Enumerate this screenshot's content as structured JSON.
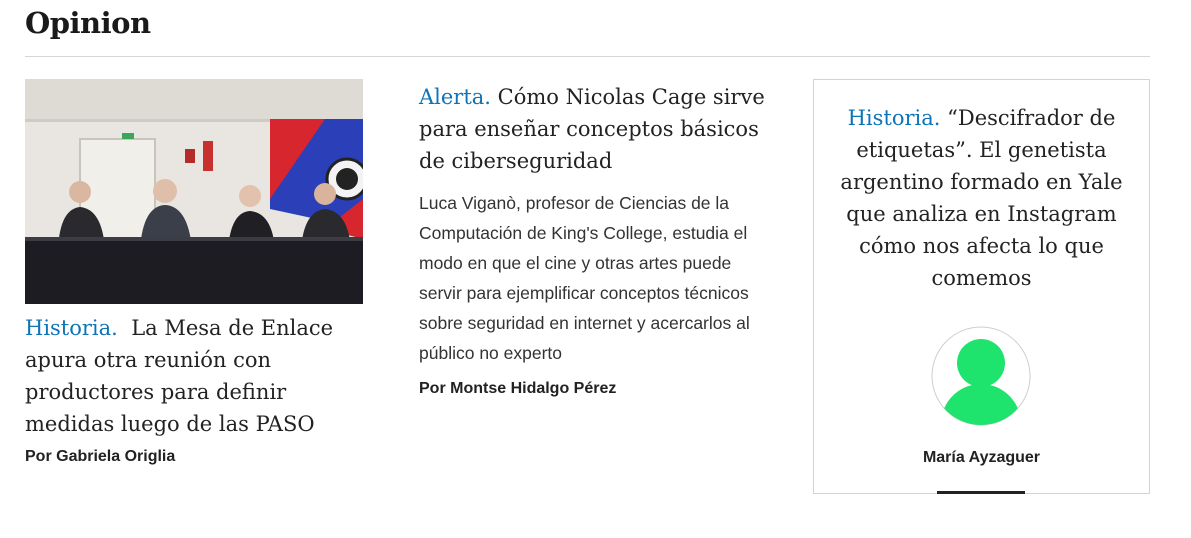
{
  "section": {
    "title": "Opinion"
  },
  "cards": [
    {
      "kicker": "Historia.",
      "headline": "La Mesa de Enlace apura otra reunión con productores para definir medidas luego de las PASO",
      "byline": "Por Gabriela Origlia"
    },
    {
      "kicker": "Alerta.",
      "headline": "Cómo Nicolas Cage sirve para enseñar conceptos básicos de ciberseguridad",
      "summary": "Luca Viganò, profesor de Ciencias de la Computación de King's College, estudia el modo en que el cine y otras artes puede servir para ejemplificar conceptos técnicos sobre seguridad en internet y acercarlos al público no experto",
      "byline": "Por Montse Hidalgo Pérez"
    },
    {
      "kicker": "Historia.",
      "headline": "“Descifrador de etiquetas”. El genetista argentino formado en Yale que analiza en Instagram cómo nos afecta lo que comemos",
      "byline": "María Ayzaguer"
    }
  ],
  "colors": {
    "kicker": "#0e73b7",
    "avatar": "#1ee36c",
    "text": "#222222"
  },
  "icons": {
    "author_avatar": "user-silhouette-icon"
  }
}
